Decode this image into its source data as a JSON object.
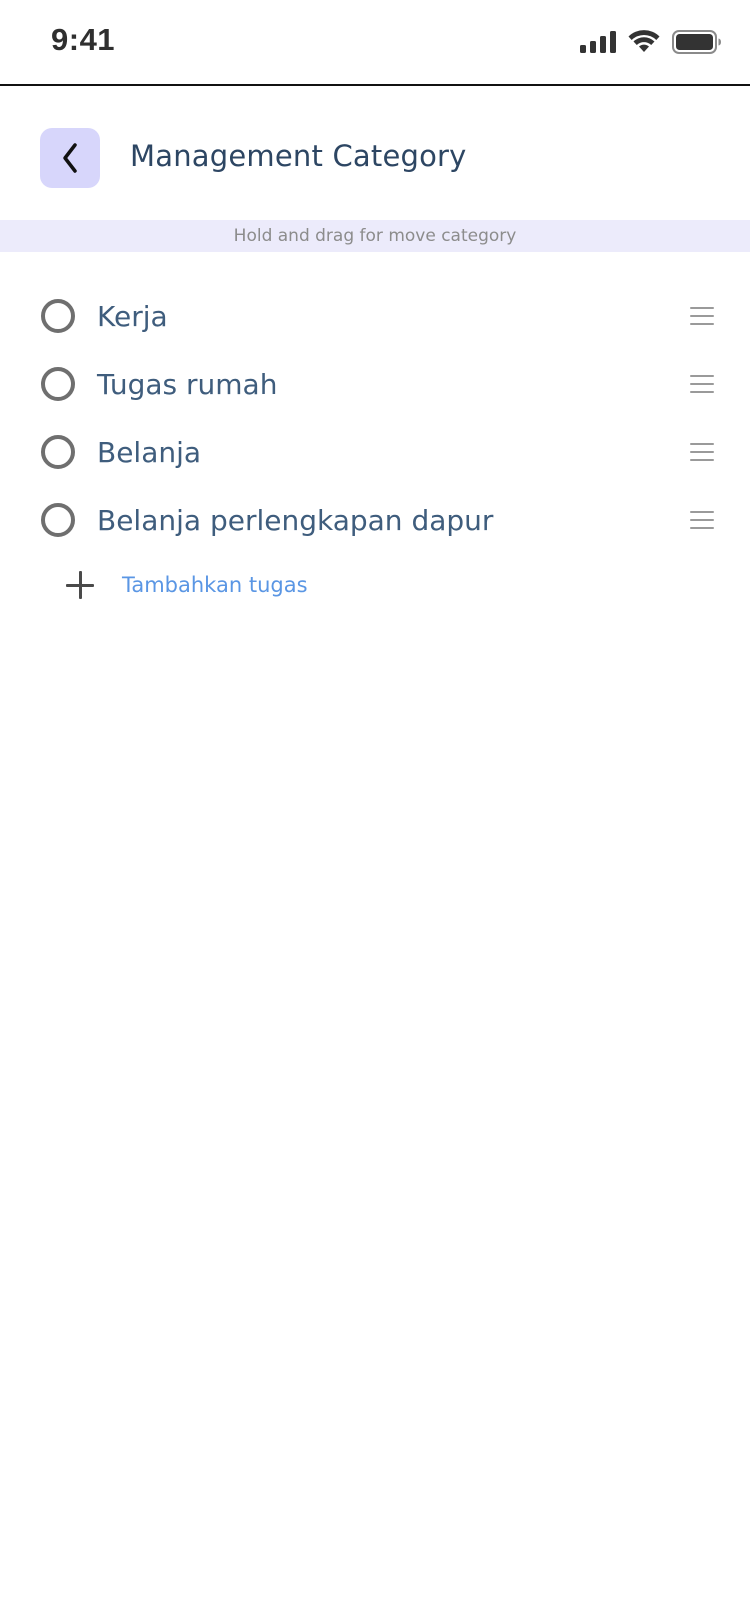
{
  "status_bar": {
    "time": "9:41",
    "icons": [
      "cellular-signal-icon",
      "wifi-icon",
      "battery-icon"
    ]
  },
  "header": {
    "back_icon": "chevron-left-icon",
    "title": "Management Category"
  },
  "hint": {
    "text": "Hold and drag for move category"
  },
  "categories": [
    {
      "label": "Kerja"
    },
    {
      "label": "Tugas rumah"
    },
    {
      "label": "Belanja"
    },
    {
      "label": "Belanja perlengkapan dapur"
    }
  ],
  "add_task": {
    "icon": "plus-icon",
    "label": "Tambahkan tugas"
  },
  "colors": {
    "accent_bg": "#d7d6fb",
    "hint_bg": "#ecebfb",
    "title": "#2d4663",
    "item_text": "#3f5d7d",
    "link": "#5a96e4"
  }
}
